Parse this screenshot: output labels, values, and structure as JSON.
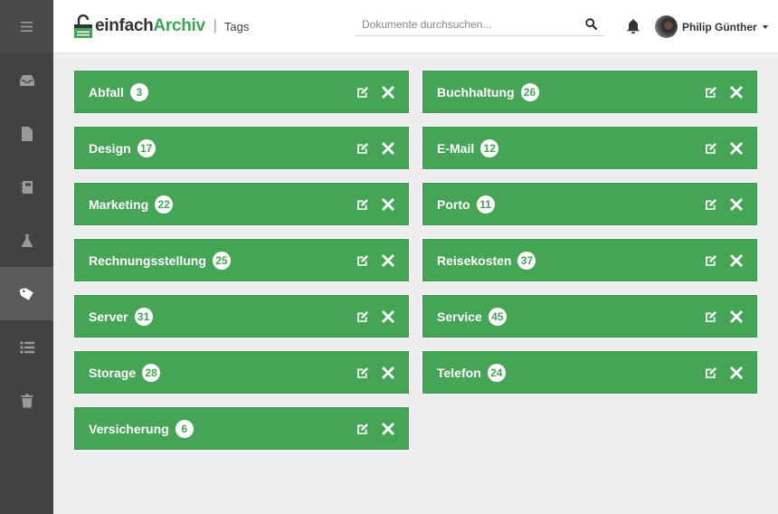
{
  "app": {
    "brand_part1": "einfach",
    "brand_part2": "Archiv",
    "page_label": "Tags",
    "brand_color": "#3fa652"
  },
  "sidebar": {
    "items": [
      {
        "name": "inbox",
        "icon": "inbox-icon",
        "active": false
      },
      {
        "name": "documents",
        "icon": "document-icon",
        "active": false
      },
      {
        "name": "address-book",
        "icon": "notebook-icon",
        "active": false
      },
      {
        "name": "lab",
        "icon": "flask-icon",
        "active": false
      },
      {
        "name": "tags",
        "icon": "tag-icon",
        "active": true
      },
      {
        "name": "lists",
        "icon": "list-icon",
        "active": false
      },
      {
        "name": "trash",
        "icon": "trash-icon",
        "active": false
      }
    ]
  },
  "search": {
    "placeholder": "Dokumente durchsuchen...",
    "value": ""
  },
  "user": {
    "name": "Philip Günther"
  },
  "tags": [
    {
      "name": "Abfall",
      "count": "3"
    },
    {
      "name": "Buchhaltung",
      "count": "26"
    },
    {
      "name": "Design",
      "count": "17"
    },
    {
      "name": "E-Mail",
      "count": "12"
    },
    {
      "name": "Marketing",
      "count": "22"
    },
    {
      "name": "Porto",
      "count": "11"
    },
    {
      "name": "Rechnungsstellung",
      "count": "25"
    },
    {
      "name": "Reisekosten",
      "count": "37"
    },
    {
      "name": "Server",
      "count": "31"
    },
    {
      "name": "Service",
      "count": "45"
    },
    {
      "name": "Storage",
      "count": "28"
    },
    {
      "name": "Telefon",
      "count": "24"
    },
    {
      "name": "Versicherung",
      "count": "6"
    }
  ],
  "colors": {
    "tag_green": "#46a457",
    "sidebar_bg": "#424242",
    "sidebar_active": "#5a5a5a",
    "content_bg": "#eeeeee"
  }
}
